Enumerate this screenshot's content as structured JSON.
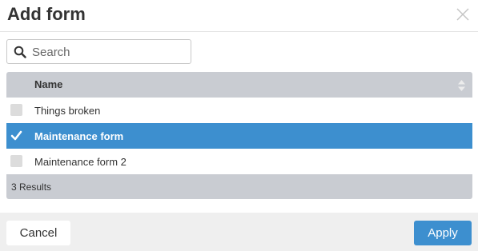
{
  "dialog": {
    "title": "Add form"
  },
  "search": {
    "placeholder": "Search",
    "value": ""
  },
  "table": {
    "column_header": "Name",
    "rows": [
      {
        "label": "Things broken",
        "selected": false
      },
      {
        "label": "Maintenance form",
        "selected": true
      },
      {
        "label": "Maintenance form 2",
        "selected": false
      }
    ],
    "results_text": "3 Results"
  },
  "footer": {
    "cancel_label": "Cancel",
    "apply_label": "Apply"
  },
  "colors": {
    "accent": "#3d8fcf",
    "table_header_bg": "#c9ccd2",
    "footer_bg": "#efefef"
  },
  "icons": {
    "close": "close-icon",
    "search": "search-icon",
    "sort": "sort-icon",
    "check": "check-icon"
  }
}
